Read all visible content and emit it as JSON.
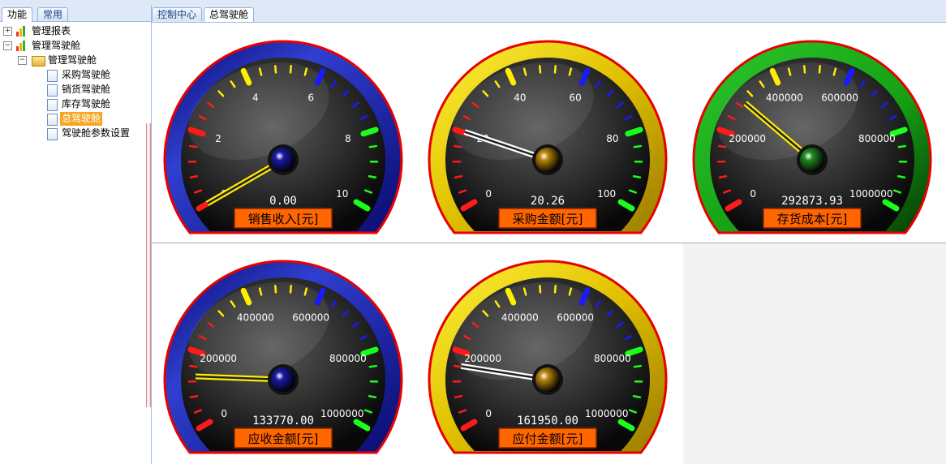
{
  "left_tabs": [
    "功能",
    "常用"
  ],
  "tree": {
    "nodes": [
      {
        "label": "管理报表",
        "expander": "+"
      },
      {
        "label": "管理驾驶舱",
        "expander": "−"
      },
      {
        "label": "管理驾驶舱",
        "expander": "−"
      },
      {
        "label": "采购驾驶舱"
      },
      {
        "label": "销货驾驶舱"
      },
      {
        "label": "库存驾驶舱"
      },
      {
        "label": "总驾驶舱"
      },
      {
        "label": "驾驶舱参数设置"
      }
    ]
  },
  "content_tabs": [
    "控制中心",
    "总驾驶舱"
  ],
  "gauges": [
    {
      "title": "销售收入[元]",
      "value": 0.0,
      "display": "0.00",
      "max": 10,
      "ticks": [
        "0",
        "2",
        "4",
        "6",
        "8",
        "10"
      ],
      "rim": "blue",
      "hub": "#1a1aa8",
      "needle": "yellow"
    },
    {
      "title": "采购金额[元]",
      "value": 20.26,
      "display": "20.26",
      "max": 100,
      "ticks": [
        "0",
        "20",
        "40",
        "60",
        "80",
        "100"
      ],
      "rim": "yellow",
      "hub": "#b8860b",
      "needle": "white"
    },
    {
      "title": "存货成本[元]",
      "value": 292873.93,
      "display": "292873.93",
      "max": 1000000,
      "ticks": [
        "0",
        "200000",
        "400000",
        "600000",
        "800000",
        "1000000"
      ],
      "rim": "green",
      "hub": "#228b22",
      "needle": "yellow"
    },
    {
      "title": "应收金额[元]",
      "value": 133770.0,
      "display": "133770.00",
      "max": 1000000,
      "ticks": [
        "0",
        "200000",
        "400000",
        "600000",
        "800000",
        "1000000"
      ],
      "rim": "blue",
      "hub": "#1a1aa8",
      "needle": "yellow"
    },
    {
      "title": "应付金额[元]",
      "value": 161950.0,
      "display": "161950.00",
      "max": 1000000,
      "ticks": [
        "0",
        "200000",
        "400000",
        "600000",
        "800000",
        "1000000"
      ],
      "rim": "yellow",
      "hub": "#b8860b",
      "needle": "white"
    }
  ]
}
